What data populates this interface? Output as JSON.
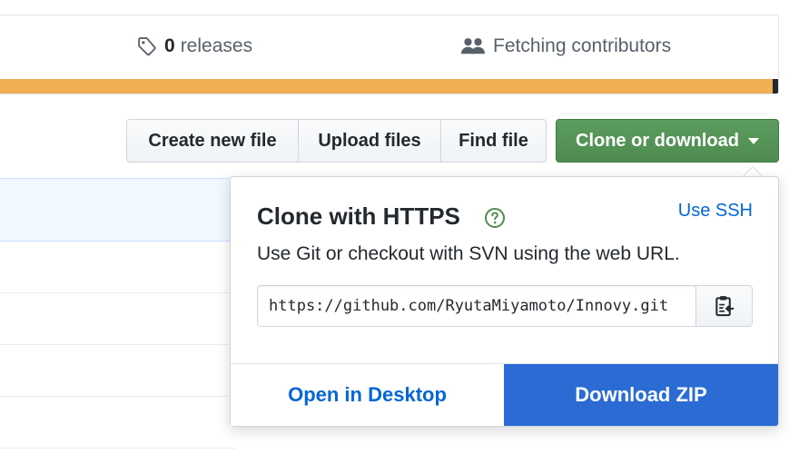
{
  "stats": {
    "releases_count": "0",
    "releases_label": "releases",
    "contributors_label": "Fetching contributors"
  },
  "toolbar": {
    "create_file": "Create new file",
    "upload_files": "Upload files",
    "find_file": "Find file",
    "clone_download": "Clone or download"
  },
  "clone_panel": {
    "title": "Clone with HTTPS",
    "use_ssh": "Use SSH",
    "description": "Use Git or checkout with SVN using the web URL.",
    "url": "https://github.com/RyutaMiyamoto/Innovy.git",
    "open_desktop": "Open in Desktop",
    "download_zip": "Download ZIP"
  },
  "icons": {
    "tag": "tag-icon",
    "people": "people-icon",
    "help": "question-icon",
    "clipboard": "clipboard-icon",
    "caret": "caret-down-icon"
  },
  "colors": {
    "green_button": "#4f8d51",
    "link_blue": "#0366d6",
    "download_blue": "#2b6bd3",
    "language_bar": "#f1ae52"
  }
}
